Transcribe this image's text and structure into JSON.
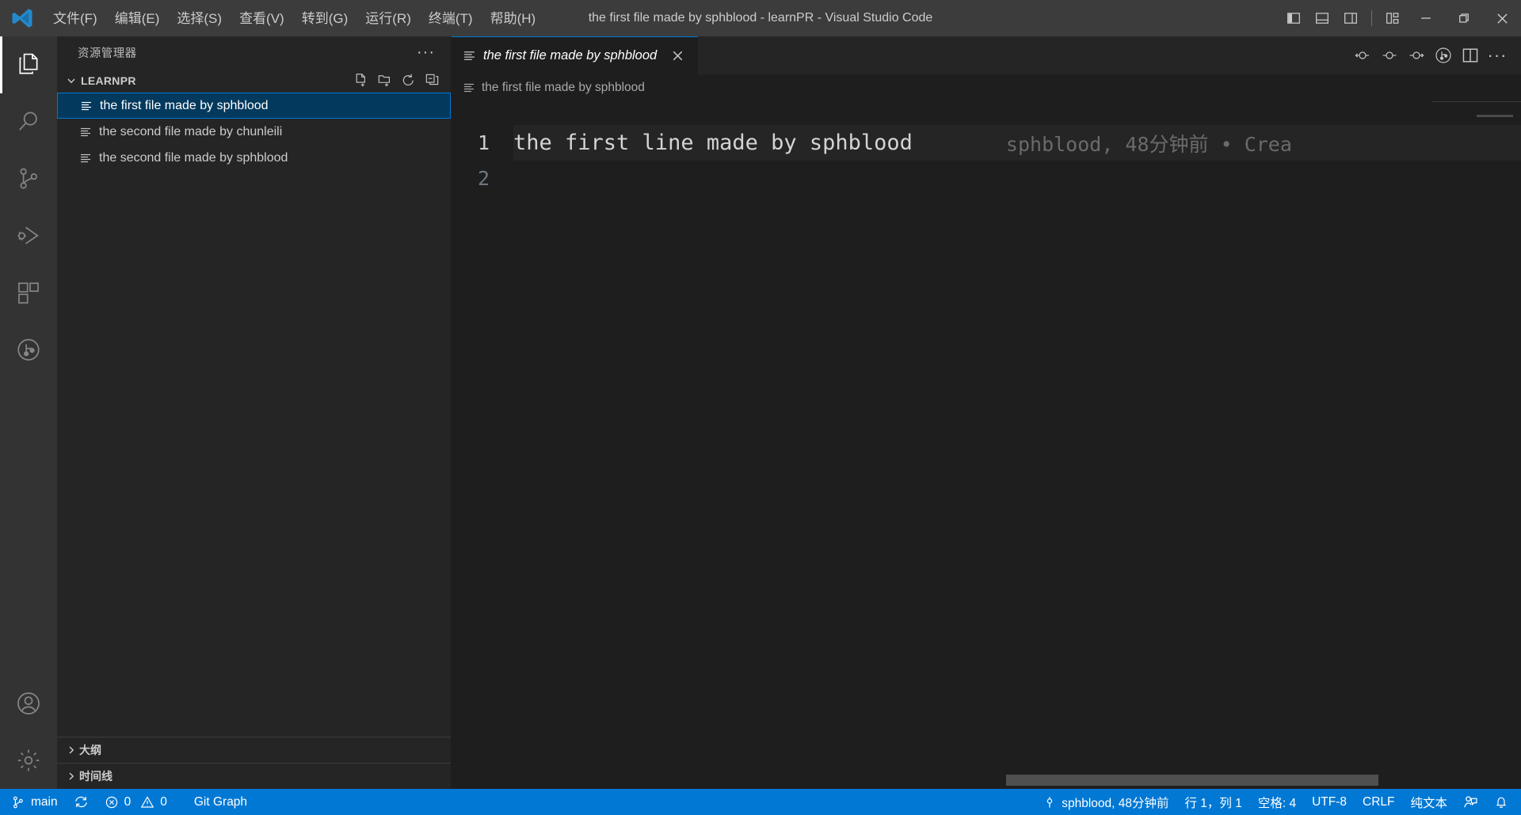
{
  "window": {
    "title": "the first file made by sphblood - learnPR - Visual Studio Code",
    "logo_icon": "vscode-logo-icon",
    "minimize_label": "─",
    "maximize_label": "❐",
    "close_label": "✕"
  },
  "menubar": {
    "items": [
      {
        "label": "文件(F)",
        "name": "menu-file"
      },
      {
        "label": "编辑(E)",
        "name": "menu-edit"
      },
      {
        "label": "选择(S)",
        "name": "menu-selection"
      },
      {
        "label": "查看(V)",
        "name": "menu-view"
      },
      {
        "label": "转到(G)",
        "name": "menu-go"
      },
      {
        "label": "运行(R)",
        "name": "menu-run"
      },
      {
        "label": "终端(T)",
        "name": "menu-terminal"
      },
      {
        "label": "帮助(H)",
        "name": "menu-help"
      }
    ]
  },
  "titlebar_layout_buttons": [
    {
      "name": "toggle-primary-sidebar-icon",
      "tooltip": "切换主侧边栏"
    },
    {
      "name": "toggle-panel-icon",
      "tooltip": "切换面板"
    },
    {
      "name": "toggle-secondary-sidebar-icon",
      "tooltip": "切换辅助侧边栏"
    },
    {
      "name": "customize-layout-icon",
      "tooltip": "自定义布局"
    }
  ],
  "activitybar": {
    "items": [
      {
        "name": "activity-explorer",
        "icon": "files-icon",
        "active": true
      },
      {
        "name": "activity-search",
        "icon": "search-icon",
        "active": false
      },
      {
        "name": "activity-source-control",
        "icon": "source-control-icon",
        "active": false
      },
      {
        "name": "activity-run-debug",
        "icon": "run-debug-icon",
        "active": false
      },
      {
        "name": "activity-extensions",
        "icon": "extensions-icon",
        "active": false
      },
      {
        "name": "activity-git-graph",
        "icon": "git-graph-icon",
        "active": false
      }
    ],
    "bottom": [
      {
        "name": "activity-accounts",
        "icon": "account-icon"
      },
      {
        "name": "activity-settings",
        "icon": "gear-icon"
      }
    ]
  },
  "sidebar": {
    "header_title": "资源管理器",
    "header_more": "···",
    "folder": {
      "name": "LEARNPR",
      "expanded": true,
      "actions": [
        {
          "name": "new-file-icon",
          "tooltip": "新建文件"
        },
        {
          "name": "new-folder-icon",
          "tooltip": "新建文件夹"
        },
        {
          "name": "refresh-icon",
          "tooltip": "在资源管理器中刷新"
        },
        {
          "name": "collapse-all-icon",
          "tooltip": "在资源管理器中全部折叠"
        }
      ]
    },
    "files": [
      {
        "label": "the first file made by sphblood",
        "selected": true
      },
      {
        "label": "the second file made by chunleili",
        "selected": false
      },
      {
        "label": "the second file made by sphblood",
        "selected": false
      }
    ],
    "panels": [
      {
        "label": "大纲",
        "expanded": false
      },
      {
        "label": "时间线",
        "expanded": false
      }
    ]
  },
  "editor": {
    "tab": {
      "label": "the first file made by sphblood",
      "icon": "text-file-icon",
      "close_label": "✕",
      "preview": true
    },
    "tab_actions": [
      {
        "name": "go-back-icon"
      },
      {
        "name": "go-to-icon"
      },
      {
        "name": "go-forward-icon"
      },
      {
        "name": "git-graph-icon"
      },
      {
        "name": "split-editor-icon"
      },
      {
        "name": "more-actions-icon",
        "label": "···"
      }
    ],
    "breadcrumb": {
      "icon": "text-file-icon",
      "label": "the first file made by sphblood"
    },
    "lines": [
      {
        "number": "1",
        "text": "the first line made by sphblood",
        "current": true
      },
      {
        "number": "2",
        "text": "",
        "current": false
      }
    ],
    "blame_annotation": "sphblood, 48分钟前 • Crea"
  },
  "statusbar": {
    "left": [
      {
        "name": "status-branch",
        "icon": "source-control-icon",
        "label": "main"
      },
      {
        "name": "status-sync",
        "icon": "sync-icon",
        "label": ""
      },
      {
        "name": "status-problems",
        "icon": "error-warning-icon",
        "label": "0",
        "label2": "0"
      },
      {
        "name": "status-git-graph",
        "icon": "",
        "label": "Git Graph"
      }
    ],
    "right": [
      {
        "name": "status-blame",
        "icon": "git-commit-icon",
        "label": "sphblood, 48分钟前"
      },
      {
        "name": "status-cursor-position",
        "label": "行 1，列 1"
      },
      {
        "name": "status-indentation",
        "label": "空格: 4"
      },
      {
        "name": "status-encoding",
        "label": "UTF-8"
      },
      {
        "name": "status-eol",
        "label": "CRLF"
      },
      {
        "name": "status-language-mode",
        "label": "纯文本"
      },
      {
        "name": "status-feedback",
        "icon": "feedback-icon",
        "label": ""
      },
      {
        "name": "status-notifications",
        "icon": "bell-icon",
        "label": ""
      }
    ]
  },
  "colors": {
    "accent": "#0078d4",
    "titlebar_bg": "#3c3c3c",
    "activitybar_bg": "#333333",
    "sidebar_bg": "#252526",
    "editor_bg": "#1e1e1e",
    "selection_bg": "#04395e",
    "statusbar_bg": "#0078d4",
    "text": "#cccccc",
    "blame_text": "#6a6a6a"
  }
}
